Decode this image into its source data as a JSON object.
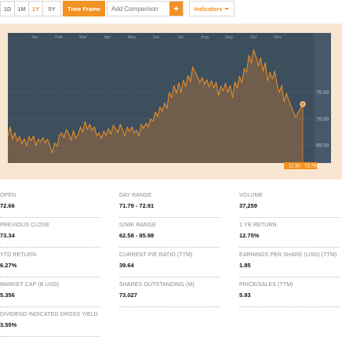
{
  "toolbar": {
    "ranges": [
      "1D",
      "1M",
      "1Y",
      "5Y"
    ],
    "active_range": "1Y",
    "time_frame_label": "Time Frame",
    "compare_placeholder": "Add Comparison",
    "compare_plus": "+",
    "indicators_label": "Indicators"
  },
  "colors": {
    "accent": "#f29224",
    "chart_bg": "#3d4f5c",
    "line": "#f29224",
    "frame": "#f8e6d2"
  },
  "chart_data": {
    "type": "area",
    "months": [
      "Jan",
      "Feb",
      "Mar",
      "Apr",
      "May",
      "Jun",
      "Jul",
      "Aug",
      "Sep",
      "Oct",
      "Nov"
    ],
    "y_ticks": [
      "75.00",
      "70.00",
      "65.00"
    ],
    "ylim": [
      61.7,
      86.2
    ],
    "current_time": "11:30",
    "current_price": "72.79",
    "values": [
      66.8,
      68.5,
      66.2,
      67.4,
      65.8,
      66.7,
      65.3,
      66.3,
      64.9,
      66.7,
      65.9,
      66.8,
      65.0,
      66.2,
      65.7,
      66.5,
      65.5,
      66.2,
      64.9,
      63.6,
      65.5,
      64.8,
      66.9,
      67.4,
      66.5,
      68.0,
      67.2,
      66.0,
      67.8,
      66.3,
      67.0,
      68.5,
      67.5,
      69.5,
      68.0,
      69.0,
      67.8,
      68.5,
      66.8,
      67.4,
      66.3,
      67.8,
      66.9,
      68.2,
      67.1,
      68.8,
      68.2,
      67.4,
      69.0,
      68.0,
      66.8,
      68.5,
      67.6,
      68.5,
      67.3,
      67.9,
      66.7,
      69.0,
      68.2,
      69.2,
      68.5,
      70.0,
      69.6,
      71.3,
      70.5,
      72.3,
      71.4,
      73.0,
      72.0,
      75.0,
      74.0,
      76.3,
      74.8,
      76.8,
      75.0,
      77.3,
      76.1,
      78.2,
      77.0,
      79.8,
      78.8,
      78.0,
      76.8,
      77.8,
      76.5,
      77.4,
      76.0,
      77.2,
      75.8,
      76.9,
      74.5,
      76.2,
      75.3,
      76.7,
      75.0,
      76.3,
      74.0,
      77.0,
      75.8,
      78.0,
      76.8,
      79.5,
      78.8,
      82.0,
      80.5,
      83.0,
      81.8,
      80.0,
      81.5,
      79.0,
      80.6,
      77.2,
      78.8,
      77.5,
      79.0,
      76.5,
      75.0,
      76.3,
      73.2,
      74.8,
      73.5,
      72.4,
      71.3,
      70.3,
      71.2,
      72.0,
      72.8
    ]
  },
  "stats": [
    {
      "label": "Open",
      "value": "72.66"
    },
    {
      "label": "Day Range",
      "value": "71.79 - 72.91"
    },
    {
      "label": "Volume",
      "value": "37,259"
    },
    {
      "label": "Previous Close",
      "value": "73.34"
    },
    {
      "label": "52wk Range",
      "value": "62.58 - 85.98"
    },
    {
      "label": "1 Yr Return",
      "value": "12.75%"
    },
    {
      "label": "YTD Return",
      "value": "6.27%"
    },
    {
      "label": "Current P/E Ratio (TTM)",
      "value": "39.64"
    },
    {
      "label": "Earnings per Share (USD) (TTM)",
      "value": "1.85"
    },
    {
      "label": "Market Cap (b USD)",
      "value": "5.356"
    },
    {
      "label": "Shares Outstanding (m)",
      "value": "73.027"
    },
    {
      "label": "Price/Sales (TTM)",
      "value": "5.93"
    },
    {
      "label": "Dividend Indicated Gross Yield",
      "value": "3.55%"
    }
  ]
}
